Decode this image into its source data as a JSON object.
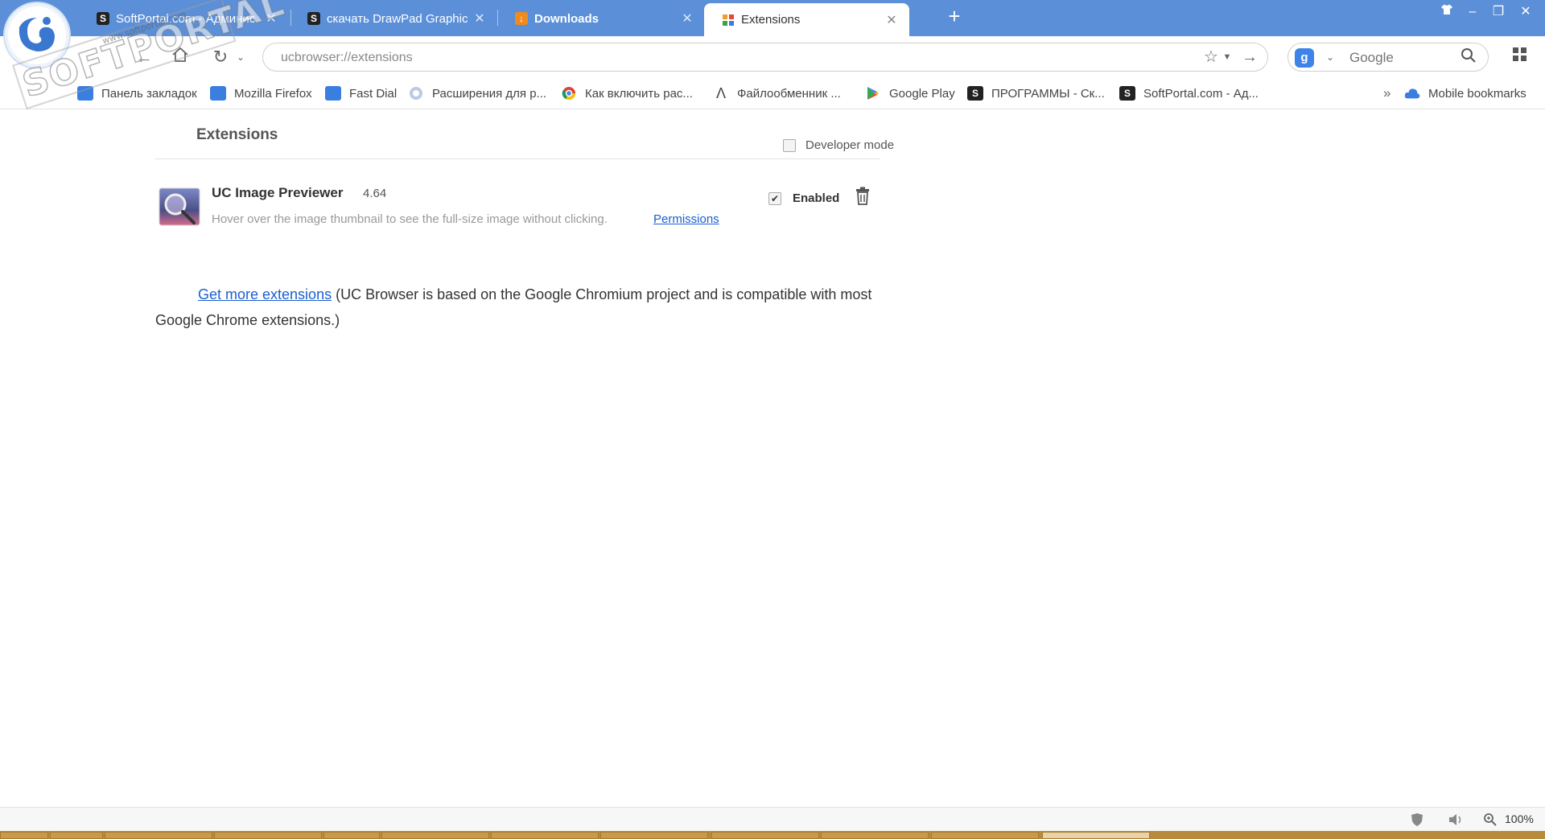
{
  "colors": {
    "titlebar": "#5b8fd8",
    "link": "#1a5fd0",
    "folder": "#3a7fe0",
    "downloads_orange": "#f08a1c"
  },
  "watermark": {
    "main": "SOFTPORTAL",
    "sub": "www.softportal.com"
  },
  "tabs": [
    {
      "title": "SoftPortal.com - Админис",
      "icon": "softportal-s-icon",
      "active": false
    },
    {
      "title": "скачать DrawPad Graphic E",
      "icon": "softportal-s-icon",
      "active": false
    },
    {
      "title": "Downloads",
      "icon": "download-arrow-icon",
      "active": false
    },
    {
      "title": "Extensions",
      "icon": "extensions-grid-icon",
      "active": true
    }
  ],
  "address": {
    "value": "ucbrowser://extensions"
  },
  "search": {
    "placeholder": "Google",
    "engine_letter": "g"
  },
  "bookmarks": {
    "items": [
      {
        "label": "Панель закладок",
        "icon": "folder-icon"
      },
      {
        "label": "Mozilla Firefox",
        "icon": "folder-icon"
      },
      {
        "label": "Fast Dial",
        "icon": "folder-icon"
      },
      {
        "label": "Расширения для р...",
        "icon": "extension-globe-icon"
      },
      {
        "label": "Как включить рас...",
        "icon": "chrome-icon"
      },
      {
        "label": "Файлообменник ...",
        "icon": "lambda-icon"
      },
      {
        "label": "Google Play",
        "icon": "google-play-icon"
      },
      {
        "label": "ПРОГРАММЫ - Ск...",
        "icon": "softportal-s-icon"
      },
      {
        "label": "SoftPortal.com - Ад...",
        "icon": "softportal-s-icon"
      }
    ],
    "overflow": "»",
    "mobile": "Mobile bookmarks"
  },
  "page": {
    "title": "Extensions",
    "developer_mode": "Developer mode",
    "developer_mode_checked": false
  },
  "extension": {
    "name": "UC Image Previewer",
    "version": "4.64",
    "description": "Hover over the image thumbnail to see the full-size image without clicking.",
    "permissions": "Permissions",
    "enabled_label": "Enabled",
    "enabled": true
  },
  "more": {
    "link": "Get more extensions",
    "text": " (UC Browser is based on the Google Chromium project and is compatible with most Google Chrome extensions.)"
  },
  "statusbar": {
    "zoom": "100%"
  }
}
